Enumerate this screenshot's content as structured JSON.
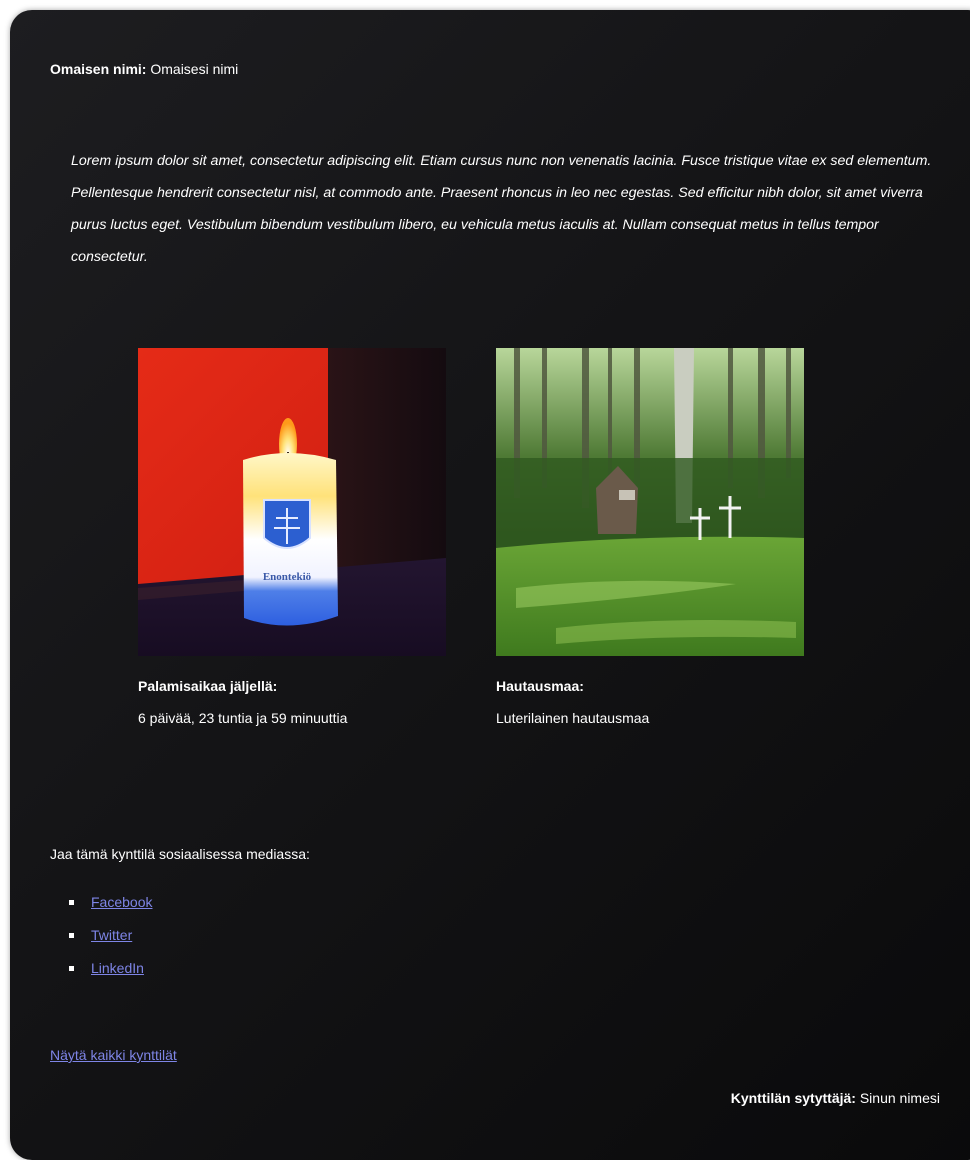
{
  "relative": {
    "label": "Omaisen nimi:",
    "value": "Omaisesi nimi"
  },
  "message": "Lorem ipsum dolor sit amet, consectetur adipiscing elit. Etiam cursus nunc non venenatis lacinia. Fusce tristique vitae ex sed elementum. Pellentesque hendrerit consectetur nisl, at commodo ante. Praesent rhoncus in leo nec egestas. Sed efficitur nibh dolor, sit amet viverra purus luctus eget. Vestibulum bibendum vestibulum libero, eu vehicula metus iaculis at. Nullam consequat metus in tellus tempor consectetur.",
  "candle": {
    "label": "Palamisaikaa jäljellä:",
    "value": "6 päivää, 23 tuntia ja 59 minuuttia",
    "candle_text": "Enontekiö"
  },
  "cemetery": {
    "label": "Hautausmaa:",
    "value": "Luterilainen hautausmaa"
  },
  "share": {
    "title": "Jaa tämä kynttilä sosiaalisessa mediassa:",
    "links": [
      "Facebook",
      "Twitter",
      "LinkedIn"
    ]
  },
  "all_candles_link": "Näytä kaikki kynttilät",
  "lighter": {
    "label": "Kynttilän sytyttäjä:",
    "value": "Sinun nimesi"
  },
  "colors": {
    "link": "#7e85e6",
    "card_background": "#141416",
    "text": "#ffffff"
  }
}
